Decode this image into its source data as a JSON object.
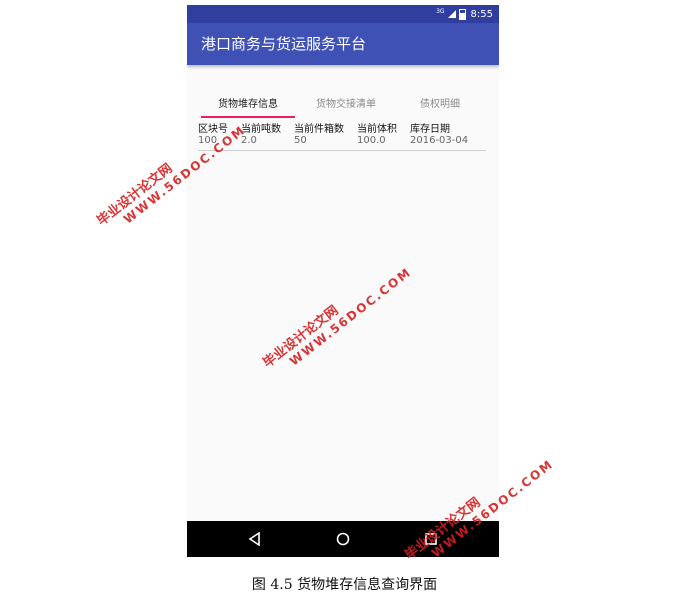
{
  "status_bar": {
    "network": "3G",
    "time": "8:55"
  },
  "app_bar": {
    "title": "港口商务与货运服务平台"
  },
  "tabs": [
    {
      "label": "货物堆存信息",
      "active": true
    },
    {
      "label": "货物交接清单",
      "active": false
    },
    {
      "label": "债权明细",
      "active": false
    }
  ],
  "table": {
    "headers": [
      "区块号",
      "当前吨数",
      "当前件箱数",
      "当前体积",
      "库存日期"
    ],
    "rows": [
      [
        "100",
        "2.0",
        "50",
        "100.0",
        "2016-03-04"
      ]
    ]
  },
  "nav_bar": {
    "back": "back-icon",
    "home": "home-icon",
    "recent": "recent-apps-icon"
  },
  "caption": "图 4.5 货物堆存信息查询界面",
  "watermark": {
    "site": "WWW.56DOC.COM",
    "name": "毕业设计论文网"
  },
  "colors": {
    "primary": "#3f51b5",
    "primary_dark": "#303f9f",
    "accent": "#e91e63",
    "watermark": "#d42020"
  }
}
